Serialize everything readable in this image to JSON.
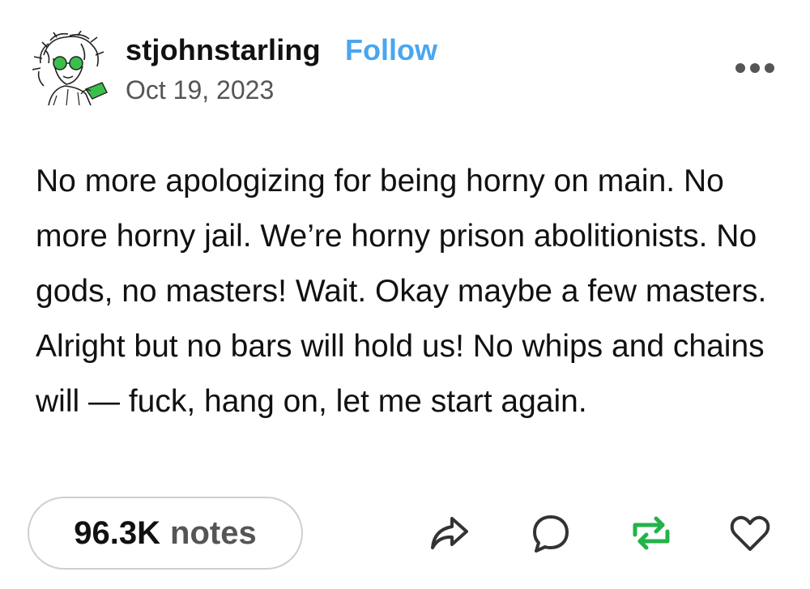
{
  "post": {
    "author": "stjohnstarling",
    "follow_label": "Follow",
    "date": "Oct 19, 2023",
    "body": "No more apologizing for being horny on main. No more horny jail. We’re horny prison abolitionists. No gods, no masters! Wait. Okay maybe a few masters. Alright but no bars will hold us! No whips and chains will — fuck, hang on, let me start again."
  },
  "footer": {
    "notes_count": "96.3K",
    "notes_label": "notes"
  },
  "icons": {
    "avatar": "avatar-illustration",
    "more": "more-options-icon",
    "share": "share-icon",
    "reply": "reply-icon",
    "reblog": "reblog-icon",
    "like": "like-icon"
  },
  "colors": {
    "accent": "#4aa6f0",
    "reblog_green": "#22b34a",
    "muted_text": "#555555",
    "pill_border": "#cfcfcf"
  }
}
